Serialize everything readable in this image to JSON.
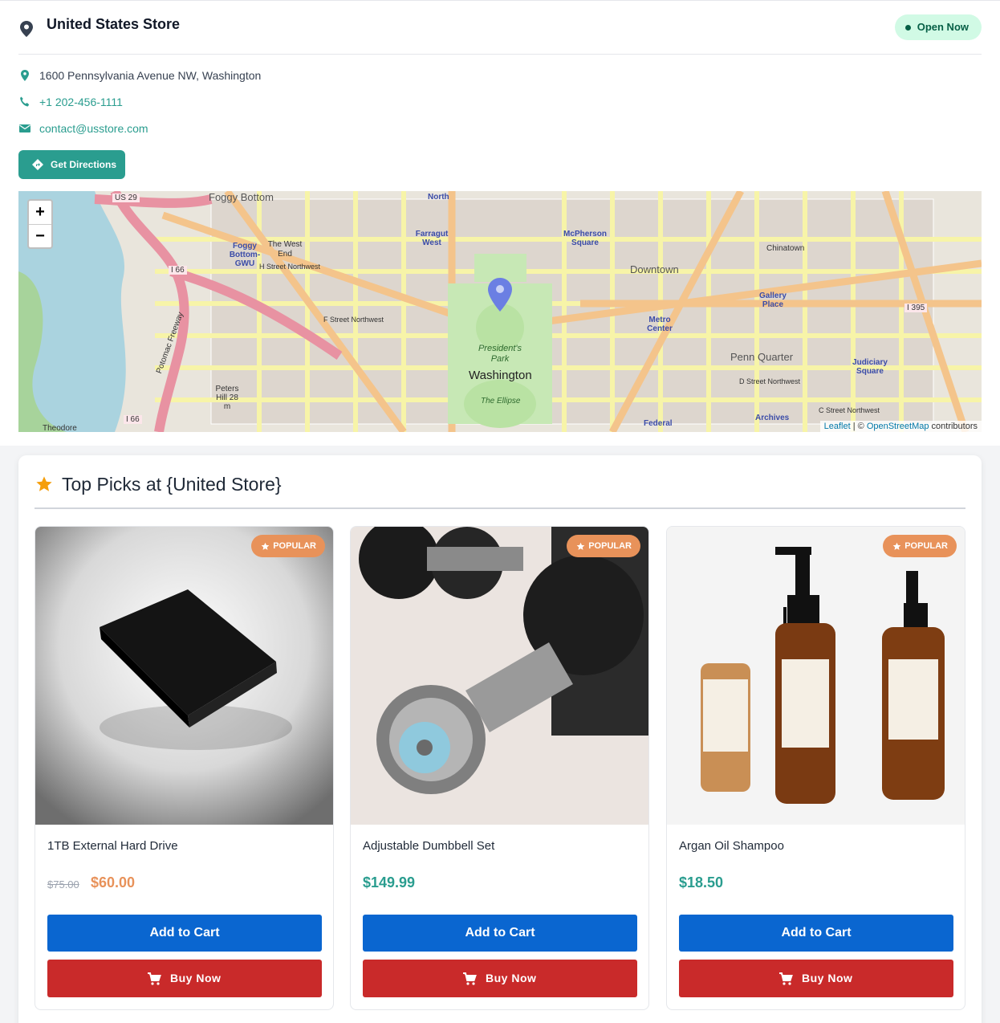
{
  "store": {
    "name": "United States Store",
    "status": "Open Now",
    "address": "1600 Pennsylvania Avenue NW, Washington",
    "phone": "+1 202-456-1111",
    "email": "contact@usstore.com",
    "directions_label": "Get Directions"
  },
  "map": {
    "zoom_in": "+",
    "zoom_out": "−",
    "attribution_leaflet": "Leaflet",
    "attribution_sep": " | © ",
    "attribution_osm": "OpenStreetMap",
    "attribution_tail": " contributors",
    "labels": {
      "foggy_bottom": "Foggy Bottom",
      "us29": "US 29",
      "north": "North",
      "farragut": "Farragut West",
      "mcpherson": "McPherson Square",
      "downtown": "Downtown",
      "chinatown": "Chinatown",
      "gallery": "Gallery Place",
      "metro_center": "Metro Center",
      "penn_quarter": "Penn Quarter",
      "judiciary": "Judiciary Square",
      "washington": "Washington",
      "presidents_park": "President's Park",
      "ellipse": "The Ellipse",
      "west_end": "The West End",
      "foggy_gwu": "Foggy Bottom-GWU",
      "i66": "I 66",
      "i395": "I 395",
      "f_street": "F Street Northwest",
      "d_street": "D Street Northwest",
      "c_street": "C Street Northwest",
      "h_street": "H Street Northwest",
      "archives": "Archives",
      "federal": "Federal",
      "peters_hill": "Peters Hill 28 m",
      "potomac_fwy": "Potomac Freeway",
      "theodore": "Theodore"
    }
  },
  "picks": {
    "title": "Top Picks at {United Store}",
    "badge": "POPULAR",
    "add_to_cart": "Add to Cart",
    "buy_now": "Buy Now",
    "products": [
      {
        "name": "1TB External Hard Drive",
        "old_price": "$75.00",
        "price": "$60.00"
      },
      {
        "name": "Adjustable Dumbbell Set",
        "price": "$149.99"
      },
      {
        "name": "Argan Oil Shampoo",
        "price": "$18.50"
      }
    ]
  },
  "colors": {
    "accent": "#2a9d8f",
    "cart_button": "#0a66d0",
    "buy_button": "#c92a2a",
    "badge": "#e8925a",
    "open_badge_bg": "#d1fae5"
  }
}
